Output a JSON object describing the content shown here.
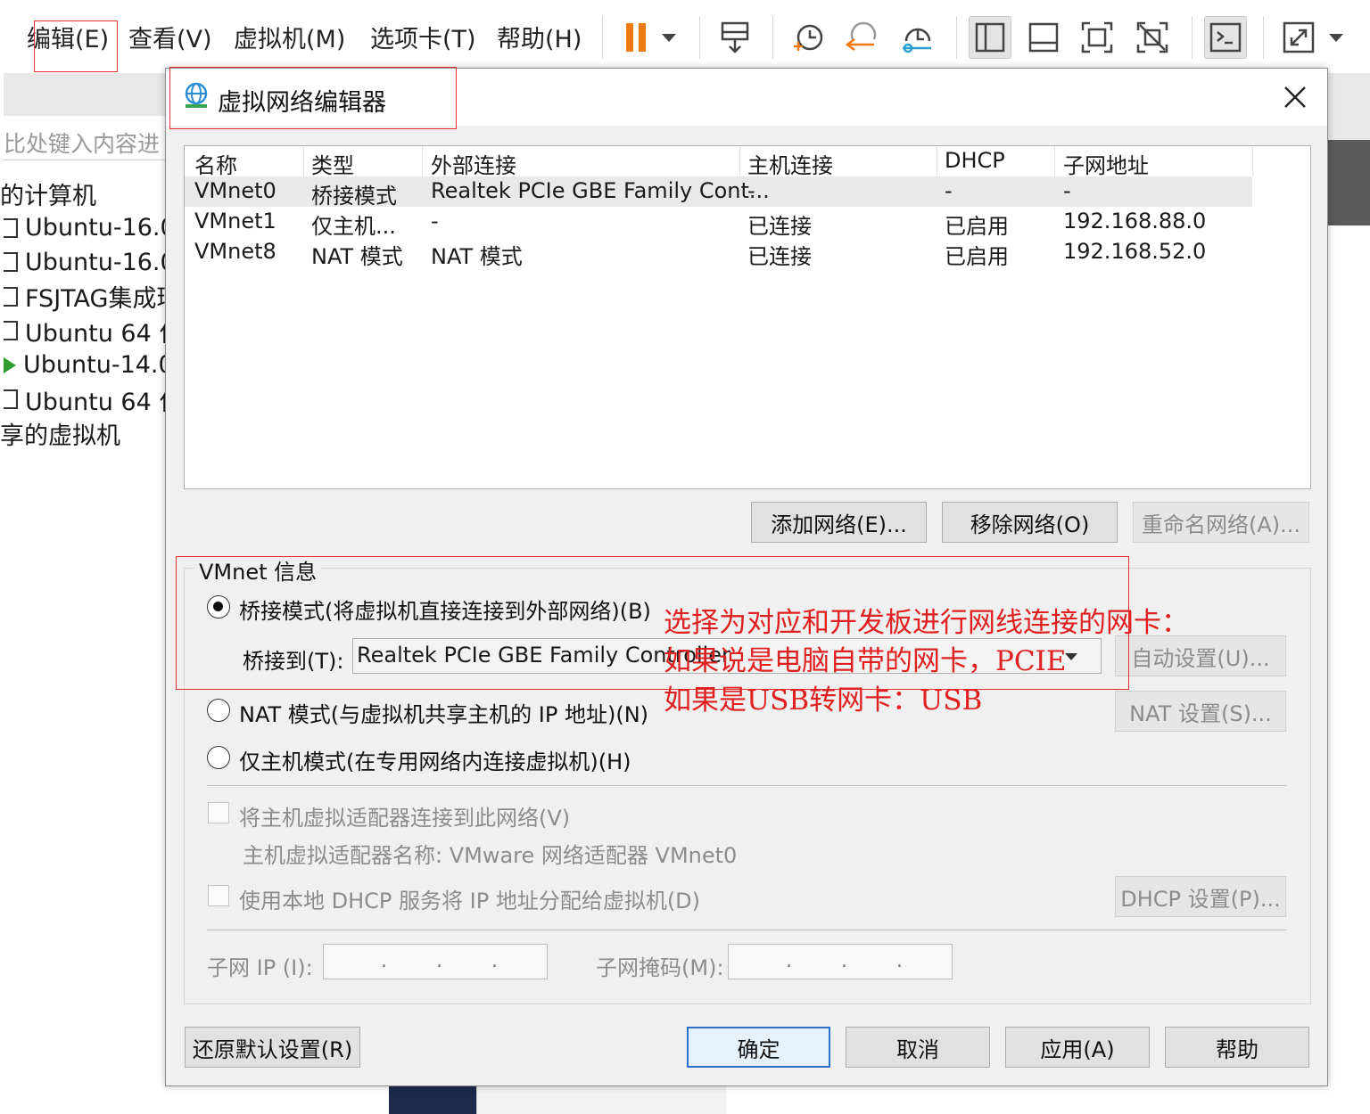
{
  "menu": [
    "编辑(E)",
    "查看(V)",
    "虚拟机(M)",
    "选项卡(T)",
    "帮助(H)"
  ],
  "toolbar_icons": [
    "pause-icon",
    "dropdown-icon",
    "send-keys-icon",
    "snapshot-icon",
    "revert-snapshot-icon",
    "snapshot-manager-icon",
    "sidebar-view-icon",
    "thumbnail-view-icon",
    "fullscreen-icon",
    "unity-icon",
    "console-icon",
    "stretch-icon"
  ],
  "library": {
    "search_placeholder": "比处键入内容进",
    "group_my_computer": "的计算机",
    "items": [
      "Ubuntu-16.0",
      "Ubuntu-16.0",
      "FSJTAG集成环",
      "Ubuntu 64 位",
      "Ubuntu-14.0",
      "Ubuntu 64 位"
    ],
    "group_shared": "享的虚拟机"
  },
  "dialog": {
    "title": "虚拟网络编辑器",
    "columns": [
      "名称",
      "类型",
      "外部连接",
      "主机连接",
      "DHCP",
      "子网地址"
    ],
    "rows": [
      [
        "VMnet0",
        "桥接模式",
        "Realtek PCIe GBE Family Cont...",
        "-",
        "-",
        "-"
      ],
      [
        "VMnet1",
        "仅主机...",
        "-",
        "已连接",
        "已启用",
        "192.168.88.0"
      ],
      [
        "VMnet8",
        "NAT 模式",
        "NAT 模式",
        "已连接",
        "已启用",
        "192.168.52.0"
      ]
    ],
    "add_network": "添加网络(E)...",
    "remove_network": "移除网络(O)",
    "rename_network": "重命名网络(A)...",
    "vmnet_info": "VMnet 信息",
    "bridged_option": "桥接模式(将虚拟机直接连接到外部网络)(B)",
    "bridge_to_label": "桥接到(T):",
    "bridge_to_value": "Realtek PCIe GBE Family Controller",
    "auto_settings": "自动设置(U)...",
    "nat_option": "NAT 模式(与虚拟机共享主机的 IP 地址)(N)",
    "nat_settings": "NAT 设置(S)...",
    "hostonly_option": "仅主机模式(在专用网络内连接虚拟机)(H)",
    "connect_adapter": "将主机虚拟适配器连接到此网络(V)",
    "adapter_name": "主机虚拟适配器名称: VMware 网络适配器 VMnet0",
    "use_dhcp": "使用本地 DHCP 服务将 IP 地址分配给虚拟机(D)",
    "dhcp_settings": "DHCP 设置(P)...",
    "subnet_ip_label": "子网 IP (I):",
    "subnet_mask_label": "子网掩码(M):",
    "restore_defaults": "还原默认设置(R)",
    "ok": "确定",
    "cancel": "取消",
    "apply": "应用(A)",
    "help": "帮助"
  },
  "annotation": {
    "line1": "选择为对应和开发板进行网线连接的网卡：",
    "line2": "如果说是电脑自带的网卡，PCIE",
    "line3": "如果是USB转网卡：USB",
    "color": "#e02020"
  },
  "colors": {
    "default_button_border": "#2d6fcd",
    "annotation_box": "#e03030"
  }
}
